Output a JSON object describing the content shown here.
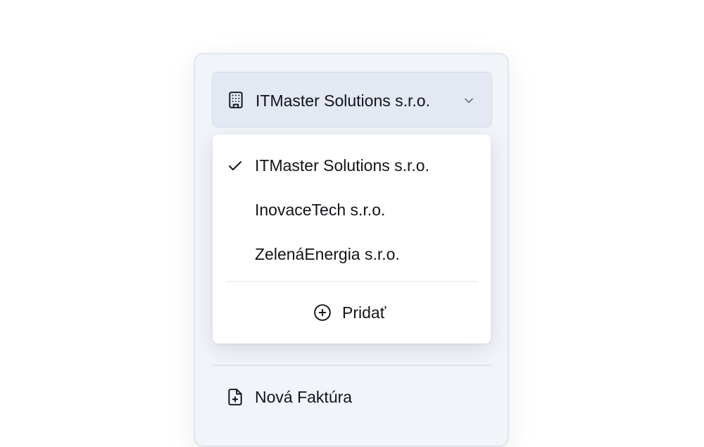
{
  "company_switcher": {
    "selected": "ITMaster Solutions s.r.o.",
    "icon": "building-icon",
    "chevron_icon": "chevron-down-icon"
  },
  "dropdown": {
    "items": [
      {
        "label": "ITMaster Solutions s.r.o.",
        "selected": true
      },
      {
        "label": "InovaceTech s.r.o.",
        "selected": false
      },
      {
        "label": "ZelenáEnergia s.r.o.",
        "selected": false
      }
    ],
    "add_label": "Pridať",
    "add_icon": "plus-circle-icon"
  },
  "sidebar": {
    "new_invoice_label": "Nová Faktúra",
    "new_invoice_icon": "file-plus-icon"
  },
  "colors": {
    "panel_bg": "#f1f4f9",
    "switcher_bg": "#e3e8f2",
    "text": "#111418",
    "menu_bg": "#ffffff"
  }
}
